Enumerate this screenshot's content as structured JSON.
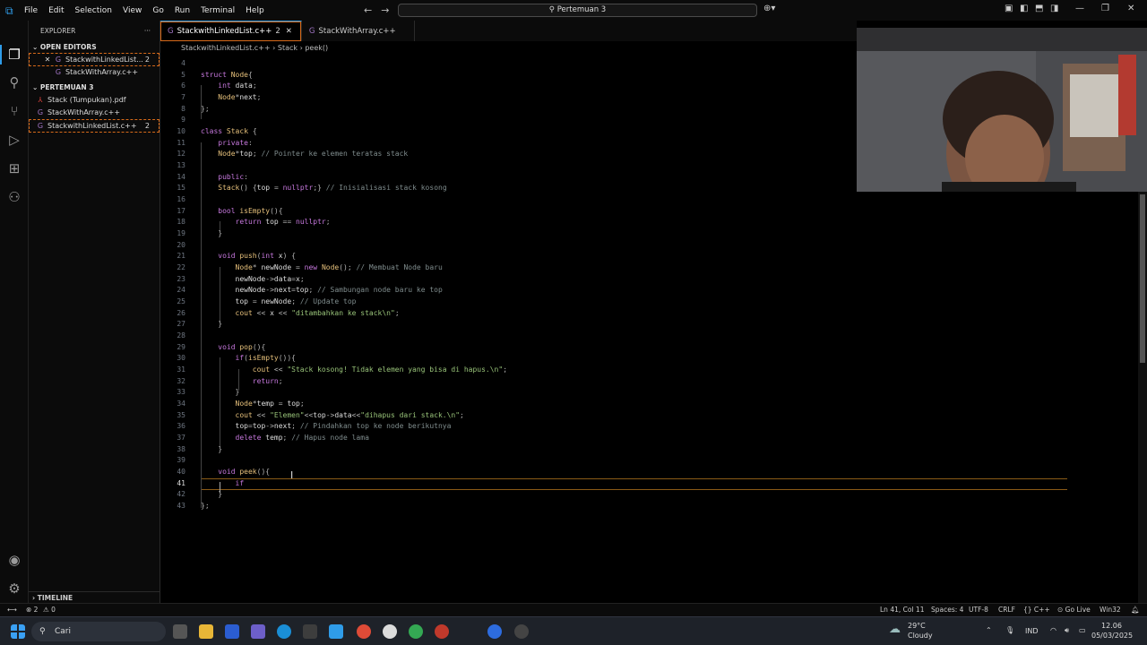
{
  "menu": [
    "File",
    "Edit",
    "Selection",
    "View",
    "Go",
    "Run",
    "Terminal",
    "Help"
  ],
  "search_box": "Pertemuan 3",
  "sidebar": {
    "explorer_label": "EXPLORER",
    "open_editors_label": "OPEN EDITORS",
    "open_editors": [
      {
        "name": "StackwithLinkedList...",
        "badge": "2"
      },
      {
        "name": "StackWithArray.c++",
        "badge": ""
      }
    ],
    "folder_label": "PERTEMUAN 3",
    "files": [
      {
        "name": "Stack (Tumpukan).pdf",
        "badge": ""
      },
      {
        "name": "StackWithArray.c++",
        "badge": ""
      },
      {
        "name": "StackwithLinkedList.c++",
        "badge": "2"
      }
    ],
    "timeline_label": "TIMELINE"
  },
  "tabs": [
    {
      "name": "StackwithLinkedList.c++",
      "badge": "2"
    },
    {
      "name": "StackWithArray.c++",
      "badge": ""
    }
  ],
  "breadcrumb": {
    "file": "StackwithLinkedList.c++",
    "sep1": "›",
    "class": "Stack",
    "sep2": "›",
    "method": "peek()"
  },
  "code_lines": [
    {
      "n": "4",
      "t": ""
    },
    {
      "n": "5",
      "t": "struct Node{"
    },
    {
      "n": "6",
      "t": "    int data;"
    },
    {
      "n": "7",
      "t": "    Node*next;"
    },
    {
      "n": "8",
      "t": "};"
    },
    {
      "n": "9",
      "t": ""
    },
    {
      "n": "10",
      "t": "class Stack {"
    },
    {
      "n": "11",
      "t": "    private:"
    },
    {
      "n": "12",
      "t": "    Node*top; // Pointer ke elemen teratas stack"
    },
    {
      "n": "13",
      "t": ""
    },
    {
      "n": "14",
      "t": "    public:"
    },
    {
      "n": "15",
      "t": "    Stack() {top = nullptr;} // Inisialisasi stack kosong"
    },
    {
      "n": "16",
      "t": ""
    },
    {
      "n": "17",
      "t": "    bool isEmpty(){"
    },
    {
      "n": "18",
      "t": "        return top == nullptr;"
    },
    {
      "n": "19",
      "t": "    }"
    },
    {
      "n": "20",
      "t": ""
    },
    {
      "n": "21",
      "t": "    void push(int x) {"
    },
    {
      "n": "22",
      "t": "        Node* newNode = new Node(); // Membuat Node baru"
    },
    {
      "n": "23",
      "t": "        newNode->data=x;"
    },
    {
      "n": "24",
      "t": "        newNode->next=top; // Sambungan node baru ke top"
    },
    {
      "n": "25",
      "t": "        top = newNode; // Update top"
    },
    {
      "n": "26",
      "t": "        cout << x << \"ditambahkan ke stack\\n\";"
    },
    {
      "n": "27",
      "t": "    }"
    },
    {
      "n": "28",
      "t": ""
    },
    {
      "n": "29",
      "t": "    void pop(){"
    },
    {
      "n": "30",
      "t": "        if(isEmpty()){"
    },
    {
      "n": "31",
      "t": "            cout << \"Stack kosong! Tidak elemen yang bisa di hapus.\\n\";"
    },
    {
      "n": "32",
      "t": "            return;"
    },
    {
      "n": "33",
      "t": "        }"
    },
    {
      "n": "34",
      "t": "        Node*temp = top;"
    },
    {
      "n": "35",
      "t": "        cout << \"Elemen\"<<top->data<<\"dihapus dari stack.\\n\";"
    },
    {
      "n": "36",
      "t": "        top=top->next; // Pindahkan top ke node berikutnya"
    },
    {
      "n": "37",
      "t": "        delete temp; // Hapus node lama"
    },
    {
      "n": "38",
      "t": "    }"
    },
    {
      "n": "39",
      "t": ""
    },
    {
      "n": "40",
      "t": "    void peek(){"
    },
    {
      "n": "41",
      "t": "        if"
    },
    {
      "n": "42",
      "t": "    }"
    },
    {
      "n": "43",
      "t": "};"
    }
  ],
  "status": {
    "errors": "⊗ 2",
    "warnings": "⚠ 0",
    "position": "Ln 41, Col 11",
    "spaces": "Spaces: 4",
    "encoding": "UTF-8",
    "eol": "CRLF",
    "lang": "{} C++",
    "golive": "⊙ Go Live",
    "platform": "Win32"
  },
  "taskbar": {
    "search": "Cari",
    "weather_temp": "29°C",
    "weather_desc": "Cloudy",
    "lang": "IND",
    "time": "12.06",
    "date": "05/03/2025"
  }
}
